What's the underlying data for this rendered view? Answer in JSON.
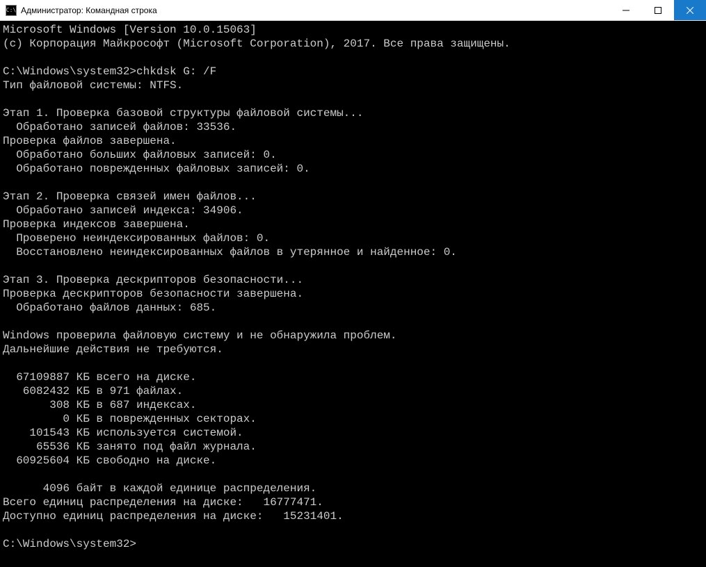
{
  "titlebar": {
    "icon_label": "C:\\",
    "title": "Администратор: Командная строка"
  },
  "terminal": {
    "lines": [
      "Microsoft Windows [Version 10.0.15063]",
      "(c) Корпорация Майкрософт (Microsoft Corporation), 2017. Все права защищены.",
      "",
      "C:\\Windows\\system32>chkdsk G: /F",
      "Тип файловой системы: NTFS.",
      "",
      "Этап 1. Проверка базовой структуры файловой системы...",
      "  Обработано записей файлов: 33536.",
      "Проверка файлов завершена.",
      "  Обработано больших файловых записей: 0.",
      "  Обработано поврежденных файловых записей: 0.",
      "",
      "Этап 2. Проверка связей имен файлов...",
      "  Обработано записей индекса: 34906.",
      "Проверка индексов завершена.",
      "  Проверено неиндексированных файлов: 0.",
      "  Восстановлено неиндексированных файлов в утерянное и найденное: 0.",
      "",
      "Этап 3. Проверка дескрипторов безопасности...",
      "Проверка дескрипторов безопасности завершена.",
      "  Обработано файлов данных: 685.",
      "",
      "Windows проверила файловую систему и не обнаружила проблем.",
      "Дальнейшие действия не требуются.",
      "",
      "  67109887 КБ всего на диске.",
      "   6082432 КБ в 971 файлах.",
      "       308 КБ в 687 индексах.",
      "         0 КБ в поврежденных секторах.",
      "    101543 КБ используется системой.",
      "     65536 КБ занято под файл журнала.",
      "  60925604 КБ свободно на диске.",
      "",
      "      4096 байт в каждой единице распределения.",
      "Всего единиц распределения на диске:   16777471.",
      "Доступно единиц распределения на диске:   15231401.",
      "",
      "C:\\Windows\\system32>"
    ]
  }
}
